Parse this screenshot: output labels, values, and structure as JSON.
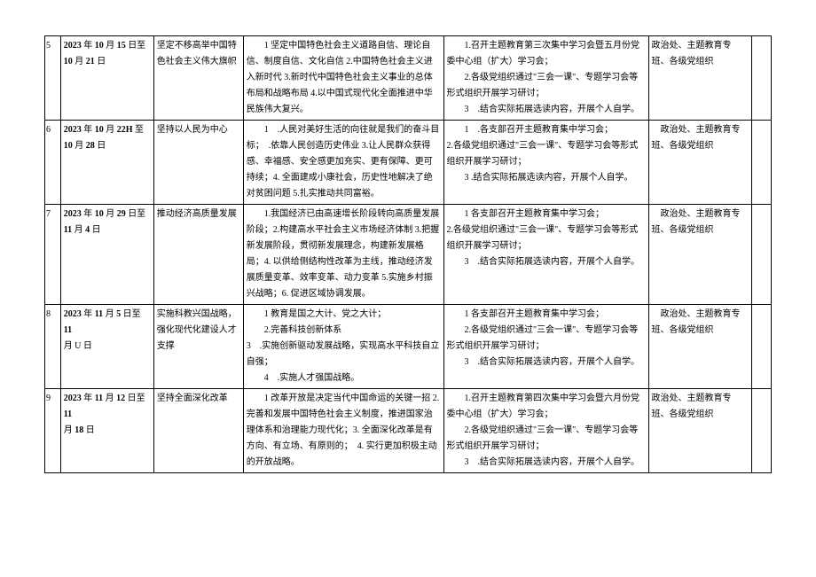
{
  "rows": [
    {
      "num": "5",
      "date_line1_bold": "2023",
      "date_line1_rest": " 年 ",
      "date_line1_bold2": "10",
      "date_line1_rest2": " 月 ",
      "date_line1_bold3": "15",
      "date_line1_rest3": " 日至",
      "date_line2_bold": "10",
      "date_line2_rest": " 月 ",
      "date_line2_bold2": "21",
      "date_line2_rest2": " 日",
      "theme": "坚定不移高举中国特色社会主义伟大旗帜",
      "key": "　　1 坚定中国特色社会主义道路自信、理论自信、制度自信、文化自信 2.中国特色社会主义进入新时代 3.新时代中国特色社会主义事业的总体布局和战略布局 4.以中国式现代化全面推进中华民族伟大复兴。",
      "study": "　　1.召开主题教育第三次集中学习会暨五月份党委中心组（扩大）学习会；\n　　2.各级党组织通过\"三会一课\"、专题学习会等形式组织开展学习研讨；\n　　3　.结合实际拓展选读内容，开展个人自学。",
      "resp": "政治处、主题教育专班、各级党组织"
    },
    {
      "num": "6",
      "date_line1_bold": "2023",
      "date_line1_rest": " 年 ",
      "date_line1_bold2": "10",
      "date_line1_rest2": " 月 ",
      "date_line1_bold3": "22H",
      "date_line1_rest3": " 至",
      "date_line2_bold": "10",
      "date_line2_rest": " 月 ",
      "date_line2_bold2": "28",
      "date_line2_rest2": " 日",
      "theme": "坚持以人民为中心",
      "key": "　　1　.人民对美好生活的向往就是我们的奋斗目标；　.依靠人民创造历史伟业 3.让人民群众获得感、幸福感、安全感更加充实、更有保障、更可持续；4. 全面建成小康社会，历史性地解决了绝对贫困问题 5.扎实推动共同富裕。",
      "study": "　　1　.各支部召开主题教育集中学习会；\n2.各级党组织通过\"三会一课\"、专题学习会等形式组织开展学习研讨；\n　　3 .结合实际拓展选读内容，开展个人自学。",
      "resp": "　政治处、主题教育专班、各级党组织"
    },
    {
      "num": "7",
      "date_line1_bold": "2023",
      "date_line1_rest": " 年 ",
      "date_line1_bold2": "10",
      "date_line1_rest2": " 月 ",
      "date_line1_bold3": "29",
      "date_line1_rest3": " 日至",
      "date_line2_bold": "11",
      "date_line2_rest": " 月 ",
      "date_line2_bold2": "4",
      "date_line2_rest2": " 日",
      "theme": "推动经济高质量发展",
      "key": "　　1.我国经济已由高速增长阶段转向高质量发展阶段；2.构建高水平社会主义市场经济体制 3.把握新发展阶段，贯彻新发展理念，构建新发展格局；4. 以供给侧结构性改革为主线，推动经济发展质量变革、效率变革、动力变革 5.实施乡村振兴战略；6. 促进区域协调发展。",
      "study": "　　1 各支部召开主题教育集中学习会；\n2.各级党组织通过\"三会一课\"、专题学习会等形式组织开展学习研讨；\n　　3　.结合实际拓展选读内容，开展个人自学。",
      "resp": "　政治处、主题教育专班、各级党组织"
    },
    {
      "num": "8",
      "date_line1_bold": "2023",
      "date_line1_rest": " 年 ",
      "date_line1_bold2": "11",
      "date_line1_rest2": " 月 ",
      "date_line1_bold3": "5",
      "date_line1_rest3": " 日至 ",
      "date_line2_bold": "11",
      "date_line2_rest": "",
      "date_line2_bold2": "",
      "date_line2_rest2": "",
      "date_line3": "月 U 日",
      "theme": "实施科教兴国战略，强化现代化建设人才支撑",
      "key": "　　1 教育是国之大计、党之大计；\n　　2.完善科技创新体系\n3　.实施创新驱动发展战略，实现高水平科技自立自强；\n　　4　.实施人才强国战略。",
      "study": "　　1 各支部召开主题教育集中学习会；\n　　2.各级党组织通过\"三会一课\"、专题学习会等形式组织开展学习研讨；\n　　3　.结合实际拓展选读内容，开展个人自学。",
      "resp": "　政治处、主题教育专班、各级党组织"
    },
    {
      "num": "9",
      "date_line1_bold": "2023",
      "date_line1_rest": " 年 ",
      "date_line1_bold2": "11",
      "date_line1_rest2": " 月 ",
      "date_line1_bold3": "12",
      "date_line1_rest3": " 日至 ",
      "date_line2_bold": "11",
      "date_line2_rest": "",
      "date_line2_bold2": "",
      "date_line2_rest2": "",
      "date_line3": "月 ",
      "date_line3_bold": "18",
      "date_line3_rest": " 日",
      "theme": "坚持全面深化改革",
      "key": "　　1 改革开放是决定当代中国命运的关键一招 2.完善和发展中国特色社会主义制度，推进国家治理体系和治理能力现代化；3. 全面深化改革是有方向、有立场、有原则的；　4. 实行更加积极主动的开放战略。",
      "study": "　　1.召开主题教育第四次集中学习会暨六月份党委中心组（扩大）学习会；\n　　2.各级党组织通过\"三会一课\"、专题学习会等形式组织开展学习研讨；\n　　3　.结合实际拓展选读内容，开展个人自学。",
      "resp": "政治处、主题教育专班、各级党组织"
    }
  ]
}
